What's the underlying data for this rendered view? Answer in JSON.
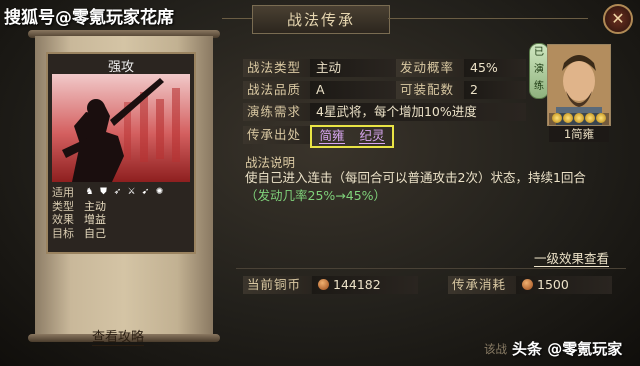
{
  "watermark_top": "搜狐号@零氪玩家花席",
  "window_title": "战法传承",
  "close_icon": "close-x-icon",
  "skill_card": {
    "name": "强攻",
    "info": [
      {
        "key": "适用",
        "value": ""
      },
      {
        "key": "类型",
        "value": "主动"
      },
      {
        "key": "效果",
        "value": "增益"
      },
      {
        "key": "目标",
        "value": "自己"
      }
    ],
    "unit_icons": [
      "cavalry-icon",
      "shield-icon",
      "archer-icon",
      "spear-icon",
      "weapon-icon",
      "siege-icon"
    ]
  },
  "guide_link": "查看攻略",
  "fields": {
    "type_label": "战法类型",
    "type_value": "主动",
    "prob_label": "发动概率",
    "prob_value": "45%",
    "quality_label": "战法品质",
    "quality_value": "A",
    "equip_label": "可装配数",
    "equip_value": "2",
    "req_label": "演练需求",
    "req_value": "4星武将，每个增加10%进度",
    "source_label": "传承出处",
    "sources": [
      "简雍",
      "纪灵"
    ]
  },
  "explain_label": "战法说明",
  "explain_text": "使自己进入连击（每回合可以普通攻击2次）状态，持续1回合",
  "explain_upgrade": "（发动几率25%→45%）",
  "more_link": "一级效果查看",
  "current_coins_label": "当前铜币",
  "current_coins_value": "144182",
  "cost_label": "传承消耗",
  "cost_value": "1500",
  "general": {
    "tag": "已演练",
    "stars": 5,
    "name": "1简雍"
  },
  "cutoff_text": "该战",
  "watermark_bottom": "头条 @零氪玩家"
}
